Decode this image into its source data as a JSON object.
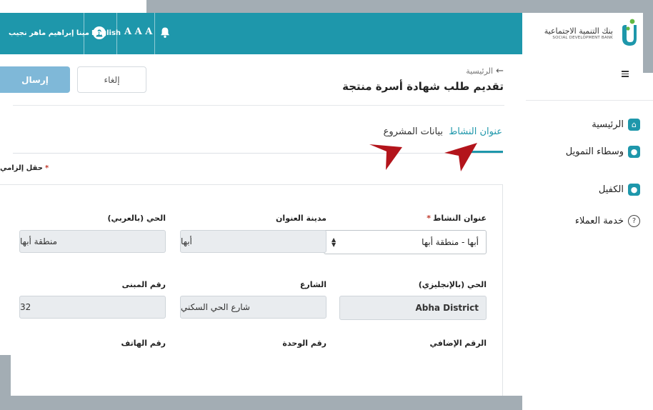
{
  "header": {
    "user_name": "مينا إبراهيم ماهر نجيب",
    "language": "English",
    "font_size": "A A A"
  },
  "brand": {
    "name_ar": "بنك التنمية الاجتماعية",
    "name_en": "SOCIAL DEVELOPMENT BANK"
  },
  "sidebar": {
    "items": [
      {
        "label": "الرئيسية"
      },
      {
        "label": "وسطاء التمويل"
      },
      {
        "label": "الكفيل"
      },
      {
        "label": "خدمة العملاء"
      }
    ]
  },
  "page": {
    "breadcrumb_arrow": "←",
    "breadcrumb": "الرئيسية",
    "title": "تقديم طلب شهادة أسرة منتجة",
    "cancel_label": "إلغاء",
    "submit_label": "إرسال"
  },
  "tabs": [
    {
      "label": "عنوان النشاط",
      "active": true
    },
    {
      "label": "بيانات المشروع",
      "active": false
    }
  ],
  "required_note": "حقل إلزامي",
  "form": {
    "activity_address": {
      "label": "عنوان النشاط",
      "value": "أبها - منطقة أبها"
    },
    "address_city": {
      "label": "مدينة العنوان",
      "value": "أبها"
    },
    "district_ar": {
      "label": "الحي (بالعربي)",
      "value": "منطقة أبها"
    },
    "district_en": {
      "label": "الحي (بالإنجليزي)",
      "value": "Abha District"
    },
    "street": {
      "label": "الشارع",
      "value": "شارع الحي السكني"
    },
    "building_no": {
      "label": "رقم المبنى",
      "value": "32"
    },
    "additional_no": {
      "label": "الرقم الإضافي"
    },
    "unit_no": {
      "label": "رقم الوحدة"
    },
    "phone_no": {
      "label": "رقم الهاتف"
    }
  },
  "colors": {
    "primary": "#1e97ab",
    "submit_disabled": "#7fb8d8",
    "annotation_arrow": "#b3141b"
  }
}
